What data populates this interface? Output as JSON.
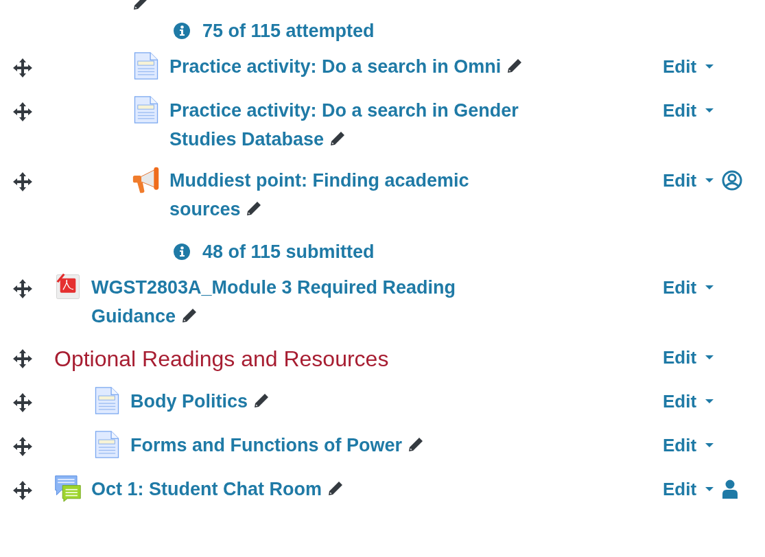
{
  "top_continuation": {
    "info": "75 of 115 attempted"
  },
  "upper_activities": [
    {
      "icon": {
        "kind": "page"
      },
      "title": "Practice activity: Do a search in Omni",
      "edit": "Edit"
    },
    {
      "icon": {
        "kind": "page"
      },
      "title": "Practice activity: Do a search in Gender Studies Database",
      "edit": "Edit"
    },
    {
      "icon": {
        "kind": "megaphone"
      },
      "title": "Muddiest point: Finding academic sources",
      "edit": "Edit",
      "badge": {
        "kind": "person-circle"
      },
      "info": "48 of 115 submitted"
    }
  ],
  "activities": [
    {
      "kind": "activity",
      "icon": {
        "kind": "pdf"
      },
      "title": "WGST2803A_Module 3 Required Reading Guidance",
      "edit": "Edit"
    },
    {
      "kind": "section",
      "title": "Optional Readings and Resources",
      "edit": "Edit",
      "children": [
        {
          "icon": {
            "kind": "page"
          },
          "title": "Body Politics",
          "edit": "Edit"
        },
        {
          "icon": {
            "kind": "page"
          },
          "title": "Forms and Functions of Power",
          "edit": "Edit"
        }
      ]
    },
    {
      "kind": "activity",
      "icon": {
        "kind": "chat"
      },
      "title": "Oct 1: Student Chat Room",
      "edit": "Edit",
      "badge": {
        "kind": "person"
      }
    }
  ]
}
